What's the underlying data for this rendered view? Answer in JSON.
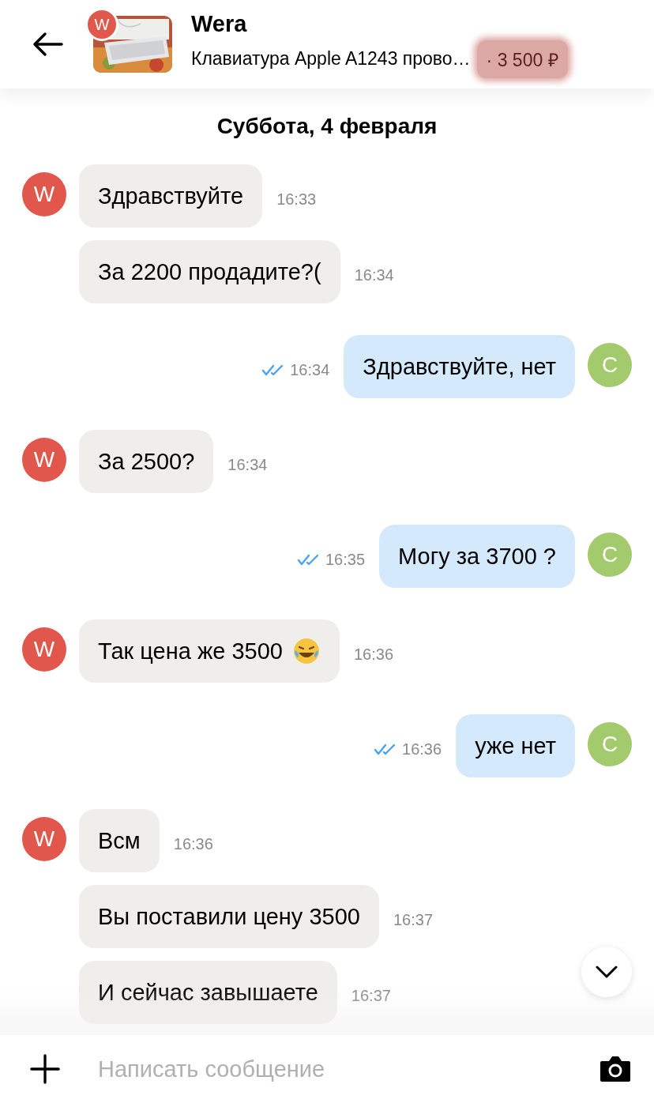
{
  "header": {
    "badge": "W",
    "name": "Wera",
    "item": "Клавиатура Apple A1243 прово…",
    "price": "· 3 500 ₽",
    "price_redacted": true
  },
  "date": "Суббота, 4 февраля",
  "messages": [
    {
      "kind": "in",
      "avatar": "W",
      "text": "Здравствуйте",
      "time": "16:33"
    },
    {
      "kind": "in",
      "text": "За 2200 продадите?(",
      "time": "16:34"
    },
    {
      "kind": "out",
      "avatar": "C",
      "text": "Здравствуйте, нет",
      "time": "16:34",
      "read": true
    },
    {
      "kind": "in",
      "avatar": "W",
      "text": "За 2500?",
      "time": "16:34"
    },
    {
      "kind": "out",
      "avatar": "C",
      "text": "Могу за 3700 ?",
      "time": "16:35",
      "read": true
    },
    {
      "kind": "in",
      "avatar": "W",
      "text": "Так цена же 3500",
      "emoji": true,
      "time": "16:36"
    },
    {
      "kind": "out",
      "avatar": "C",
      "text": "уже нет",
      "time": "16:36",
      "read": true
    },
    {
      "kind": "in",
      "avatar": "W",
      "text": "Всм",
      "time": "16:36"
    },
    {
      "kind": "in",
      "text": "Вы поставили цену 3500",
      "time": "16:37"
    },
    {
      "kind": "in",
      "text": "И сейчас завышаете",
      "time": "16:37"
    }
  ],
  "composer": {
    "placeholder": "Написать сообщение"
  }
}
